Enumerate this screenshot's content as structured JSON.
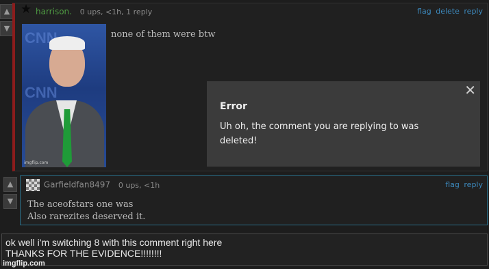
{
  "comment1": {
    "author": "harrison.",
    "meta": "0 ups, <1h, 1 reply",
    "actions": [
      "flag",
      "delete",
      "reply"
    ],
    "text": "none of them were btw",
    "image_watermark": "imgflip.com",
    "image_logo": "CNN"
  },
  "vote_icons": {
    "up": "▲",
    "down": "▼"
  },
  "popup": {
    "close": "✕",
    "title": "Error",
    "message": "Uh oh, the comment you are replying to was deleted!"
  },
  "comment2": {
    "author": "Garfieldfan8497",
    "meta": "0 ups, <1h",
    "actions": [
      "flag",
      "reply"
    ],
    "text_line1": "The aceofstars one was",
    "text_line2": "Also rarezites deserved it."
  },
  "reply_box": {
    "value": "ok well i'm switching 8 with this comment right here\nTHANKS FOR THE EVIDENCE!!!!!!!!"
  },
  "footer": {
    "watermark": "imgflip.com"
  },
  "colors": {
    "accent": "#8b1c1c",
    "link": "#3c89bd",
    "author_green": "#4f9b43",
    "reply_border": "#2a6f8a"
  }
}
